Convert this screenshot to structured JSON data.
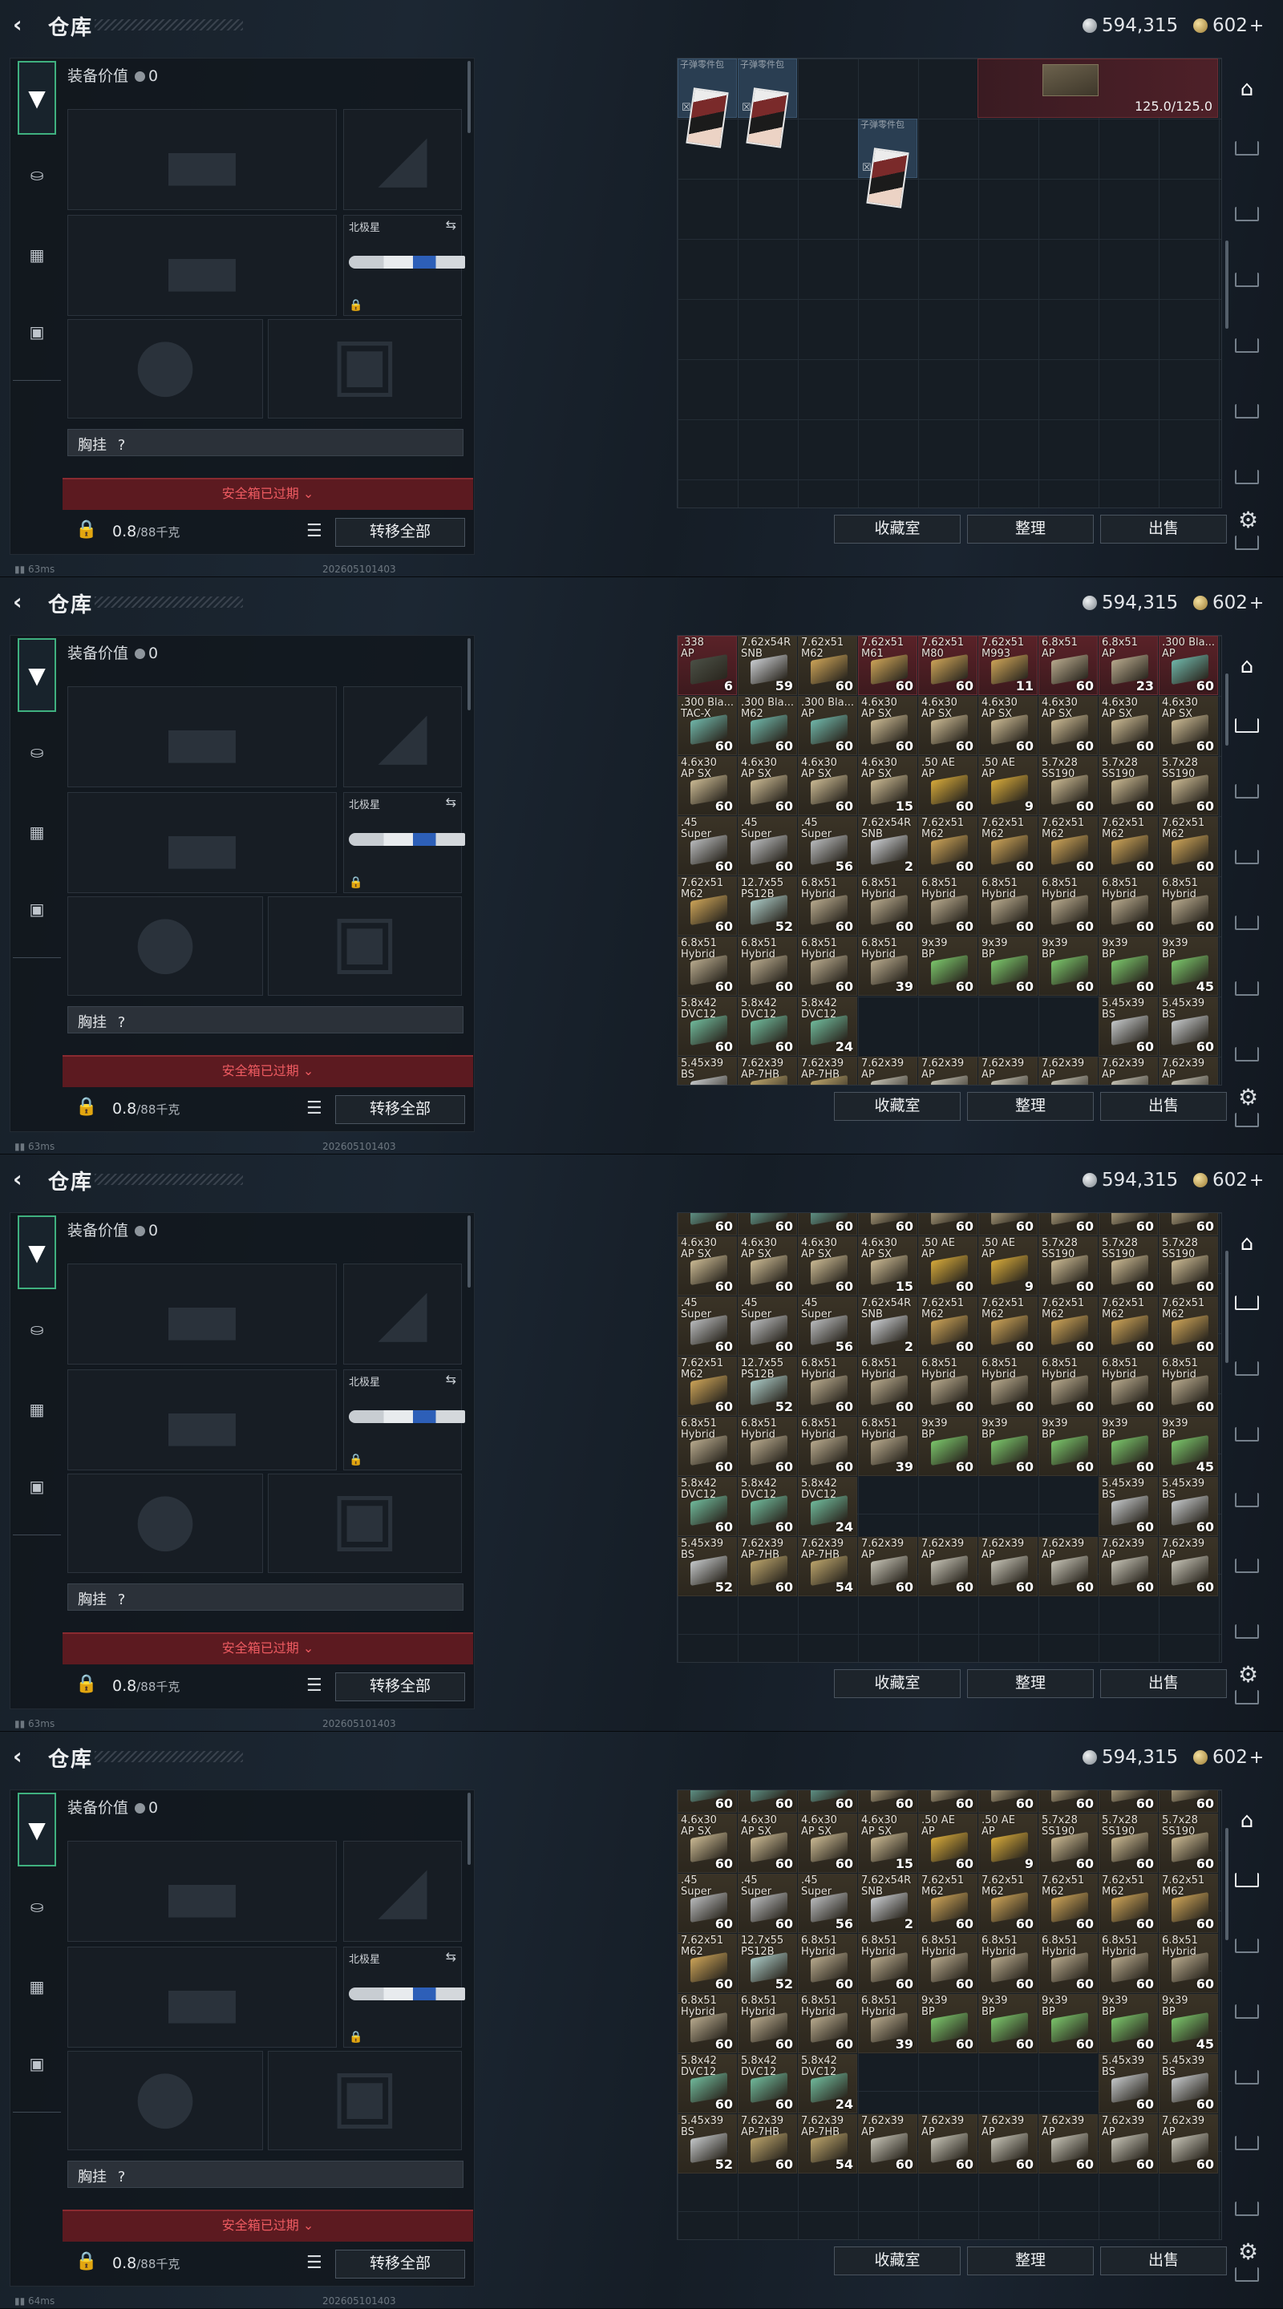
{
  "header": {
    "title": "仓库",
    "silver": "594,315",
    "gold": "602",
    "gold_plus": "+"
  },
  "equipment": {
    "value_label": "装备价值",
    "value": "0",
    "knife_label": "北极星",
    "chest_label": "胸挂",
    "chest_value": "?",
    "safebox_text": "安全箱已过期",
    "weight": "0.8",
    "weight_max": "/88千克",
    "transfer_all": "转移全部"
  },
  "actions": {
    "collection": "收藏室",
    "organize": "整理",
    "sell": "出售"
  },
  "top_storage": {
    "card_label": "子弹零件包",
    "crate_capacity": "125.0/125.0"
  },
  "status": [
    {
      "ping": "63ms",
      "build": "202605101403"
    },
    {
      "ping": "63ms",
      "build": "202605101403"
    },
    {
      "ping": "63ms",
      "build": "202605101403"
    },
    {
      "ping": "64ms",
      "build": "202605101403"
    }
  ],
  "ammo_rows": [
    [
      {
        "l1": ".338",
        "l2": "AP",
        "q": "6",
        "c": "#4a4f45",
        "red": true
      },
      {
        "l1": "7.62x54R",
        "l2": "SNB",
        "q": "59",
        "c": "#c8cbcf"
      },
      {
        "l1": "7.62x51",
        "l2": "M62",
        "q": "60",
        "c": "#caa257"
      },
      {
        "l1": "7.62x51",
        "l2": "M61",
        "q": "60",
        "c": "#caa257",
        "red": true
      },
      {
        "l1": "7.62x51",
        "l2": "M80",
        "q": "60",
        "c": "#caa257",
        "red": true
      },
      {
        "l1": "7.62x51",
        "l2": "M993",
        "q": "11",
        "c": "#caa257",
        "red": true
      },
      {
        "l1": "6.8x51",
        "l2": "AP",
        "q": "60",
        "c": "#b6a88c",
        "red": true
      },
      {
        "l1": "6.8x51",
        "l2": "AP",
        "q": "23",
        "c": "#b6a88c",
        "red": true
      },
      {
        "l1": ".300 Bla...",
        "l2": "AP",
        "q": "60",
        "c": "#6fb5a8",
        "red": true
      }
    ],
    [
      {
        "l1": ".300 Bla...",
        "l2": "TAC-X",
        "q": "60",
        "c": "#6fb5a8"
      },
      {
        "l1": ".300 Bla...",
        "l2": "M62",
        "q": "60",
        "c": "#6fb5a8"
      },
      {
        "l1": ".300 Bla...",
        "l2": "AP",
        "q": "60",
        "c": "#6fb5a8"
      },
      {
        "l1": "4.6x30",
        "l2": "AP SX",
        "q": "60",
        "c": "#c9b892"
      },
      {
        "l1": "4.6x30",
        "l2": "AP SX",
        "q": "60",
        "c": "#c9b892"
      },
      {
        "l1": "4.6x30",
        "l2": "AP SX",
        "q": "60",
        "c": "#c9b892"
      },
      {
        "l1": "4.6x30",
        "l2": "AP SX",
        "q": "60",
        "c": "#c9b892"
      },
      {
        "l1": "4.6x30",
        "l2": "AP SX",
        "q": "60",
        "c": "#c9b892"
      },
      {
        "l1": "4.6x30",
        "l2": "AP SX",
        "q": "60",
        "c": "#c9b892"
      }
    ],
    [
      {
        "l1": "4.6x30",
        "l2": "AP SX",
        "q": "60",
        "c": "#c9b892"
      },
      {
        "l1": "4.6x30",
        "l2": "AP SX",
        "q": "60",
        "c": "#c9b892"
      },
      {
        "l1": "4.6x30",
        "l2": "AP SX",
        "q": "60",
        "c": "#c9b892"
      },
      {
        "l1": "4.6x30",
        "l2": "AP SX",
        "q": "15",
        "c": "#c9b892"
      },
      {
        "l1": ".50 AE",
        "l2": "AP",
        "q": "60",
        "c": "#d4a83a"
      },
      {
        "l1": ".50 AE",
        "l2": "AP",
        "q": "9",
        "c": "#d4a83a"
      },
      {
        "l1": "5.7x28",
        "l2": "SS190",
        "q": "60",
        "c": "#c9b892"
      },
      {
        "l1": "5.7x28",
        "l2": "SS190",
        "q": "60",
        "c": "#c9b892"
      },
      {
        "l1": "5.7x28",
        "l2": "SS190",
        "q": "60",
        "c": "#c9b892"
      }
    ],
    [
      {
        "l1": ".45",
        "l2": "Super",
        "q": "60",
        "c": "#b7b9bb"
      },
      {
        "l1": ".45",
        "l2": "Super",
        "q": "60",
        "c": "#b7b9bb"
      },
      {
        "l1": ".45",
        "l2": "Super",
        "q": "56",
        "c": "#b7b9bb"
      },
      {
        "l1": "7.62x54R",
        "l2": "SNB",
        "q": "2",
        "c": "#c8cbcf"
      },
      {
        "l1": "7.62x51",
        "l2": "M62",
        "q": "60",
        "c": "#caa257"
      },
      {
        "l1": "7.62x51",
        "l2": "M62",
        "q": "60",
        "c": "#caa257"
      },
      {
        "l1": "7.62x51",
        "l2": "M62",
        "q": "60",
        "c": "#caa257"
      },
      {
        "l1": "7.62x51",
        "l2": "M62",
        "q": "60",
        "c": "#caa257"
      },
      {
        "l1": "7.62x51",
        "l2": "M62",
        "q": "60",
        "c": "#caa257"
      }
    ],
    [
      {
        "l1": "7.62x51",
        "l2": "M62",
        "q": "60",
        "c": "#caa257"
      },
      {
        "l1": "12.7x55",
        "l2": "PS12B",
        "q": "52",
        "c": "#a9c8c4"
      },
      {
        "l1": "6.8x51",
        "l2": "Hybrid",
        "q": "60",
        "c": "#b6a88c"
      },
      {
        "l1": "6.8x51",
        "l2": "Hybrid",
        "q": "60",
        "c": "#b6a88c"
      },
      {
        "l1": "6.8x51",
        "l2": "Hybrid",
        "q": "60",
        "c": "#b6a88c"
      },
      {
        "l1": "6.8x51",
        "l2": "Hybrid",
        "q": "60",
        "c": "#b6a88c"
      },
      {
        "l1": "6.8x51",
        "l2": "Hybrid",
        "q": "60",
        "c": "#b6a88c"
      },
      {
        "l1": "6.8x51",
        "l2": "Hybrid",
        "q": "60",
        "c": "#b6a88c"
      },
      {
        "l1": "6.8x51",
        "l2": "Hybrid",
        "q": "60",
        "c": "#b6a88c"
      }
    ],
    [
      {
        "l1": "6.8x51",
        "l2": "Hybrid",
        "q": "60",
        "c": "#b6a88c"
      },
      {
        "l1": "6.8x51",
        "l2": "Hybrid",
        "q": "60",
        "c": "#b6a88c"
      },
      {
        "l1": "6.8x51",
        "l2": "Hybrid",
        "q": "60",
        "c": "#b6a88c"
      },
      {
        "l1": "6.8x51",
        "l2": "Hybrid",
        "q": "39",
        "c": "#b6a88c"
      },
      {
        "l1": "9x39",
        "l2": "BP",
        "q": "60",
        "c": "#7ac46a"
      },
      {
        "l1": "9x39",
        "l2": "BP",
        "q": "60",
        "c": "#7ac46a"
      },
      {
        "l1": "9x39",
        "l2": "BP",
        "q": "60",
        "c": "#7ac46a"
      },
      {
        "l1": "9x39",
        "l2": "BP",
        "q": "60",
        "c": "#7ac46a"
      },
      {
        "l1": "9x39",
        "l2": "BP",
        "q": "45",
        "c": "#7ac46a"
      }
    ],
    [
      {
        "l1": "5.8x42",
        "l2": "DVC12",
        "q": "60",
        "c": "#6fb89a"
      },
      {
        "l1": "5.8x42",
        "l2": "DVC12",
        "q": "60",
        "c": "#6fb89a"
      },
      {
        "l1": "5.8x42",
        "l2": "DVC12",
        "q": "24",
        "c": "#6fb89a"
      },
      null,
      null,
      null,
      null,
      {
        "l1": "5.45x39",
        "l2": "BS",
        "q": "60",
        "c": "#c3c6c8"
      },
      {
        "l1": "5.45x39",
        "l2": "BS",
        "q": "60",
        "c": "#c3c6c8"
      }
    ],
    [
      {
        "l1": "5.45x39",
        "l2": "BS",
        "q": "52",
        "c": "#c3c6c8"
      },
      {
        "l1": "7.62x39",
        "l2": "AP-7HB",
        "q": "60",
        "c": "#b9a26a"
      },
      {
        "l1": "7.62x39",
        "l2": "AP-7HB",
        "q": "54",
        "c": "#b9a26a"
      },
      {
        "l1": "7.62x39",
        "l2": "AP",
        "q": "60",
        "c": "#c3c0b3"
      },
      {
        "l1": "7.62x39",
        "l2": "AP",
        "q": "60",
        "c": "#c3c0b3"
      },
      {
        "l1": "7.62x39",
        "l2": "AP",
        "q": "60",
        "c": "#c3c0b3"
      },
      {
        "l1": "7.62x39",
        "l2": "AP",
        "q": "60",
        "c": "#c3c0b3"
      },
      {
        "l1": "7.62x39",
        "l2": "AP",
        "q": "60",
        "c": "#c3c0b3"
      },
      {
        "l1": "7.62x39",
        "l2": "AP",
        "q": "60",
        "c": "#c3c0b3"
      }
    ]
  ]
}
